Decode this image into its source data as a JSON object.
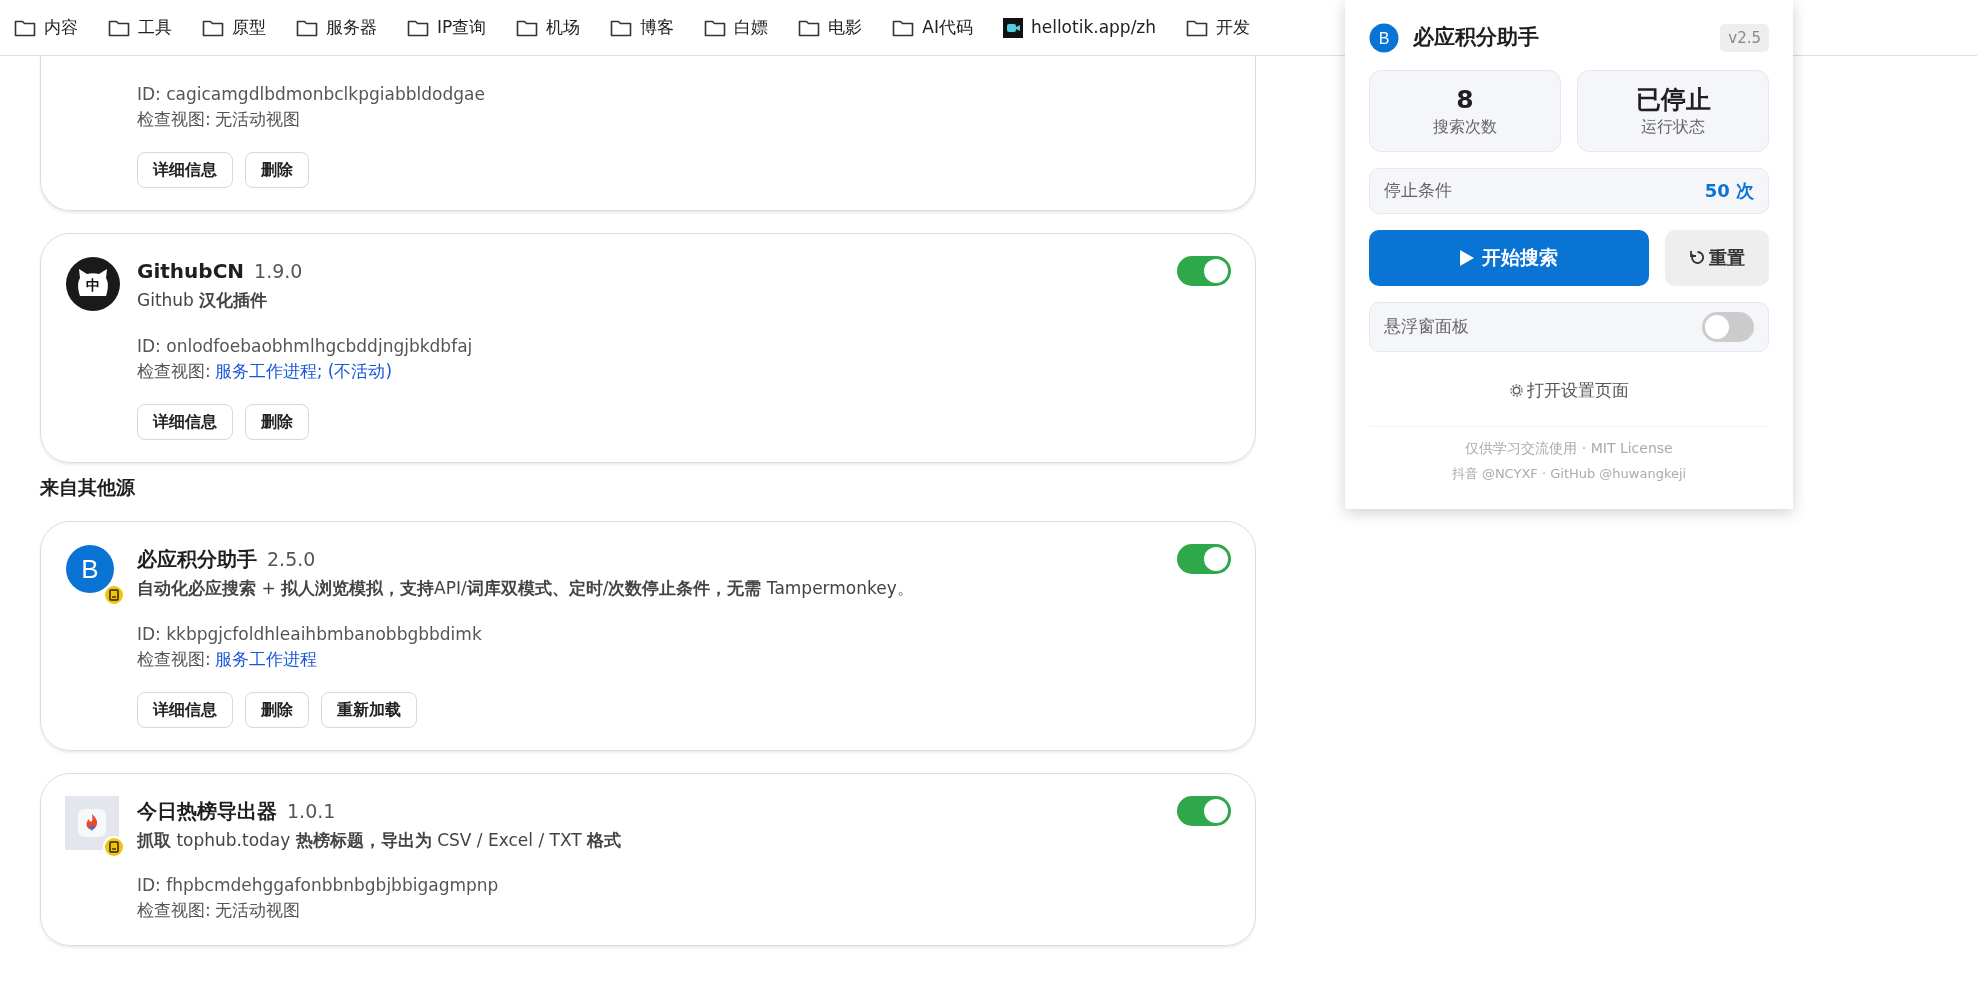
{
  "bookmarks": [
    {
      "label": "内容",
      "kind": "folder"
    },
    {
      "label": "工具",
      "kind": "folder"
    },
    {
      "label": "原型",
      "kind": "folder"
    },
    {
      "label": "服务器",
      "kind": "folder"
    },
    {
      "label": "IP查询",
      "kind": "folder"
    },
    {
      "label": "机场",
      "kind": "folder"
    },
    {
      "label": "博客",
      "kind": "folder"
    },
    {
      "label": "白嫖",
      "kind": "folder"
    },
    {
      "label": "电影",
      "kind": "folder"
    },
    {
      "label": "AI代码",
      "kind": "folder"
    },
    {
      "label": "hellotik.app/zh",
      "kind": "site"
    },
    {
      "label": "开发",
      "kind": "folder"
    }
  ],
  "extensions": [
    {
      "kind": "partial",
      "id": "ID: cagicamgdlbdmonbclkpgiabbldodgae",
      "inspect": {
        "label": "检查视图:",
        "value": "无活动视图",
        "kind": "text"
      },
      "buttons": [
        "详细信息",
        "删除"
      ]
    },
    {
      "kind": "full",
      "icon_text": "中",
      "name": "GithubCN",
      "version": "1.9.0",
      "description": "Github **汉化插件**",
      "id": "ID: onlodfoebaobhmlhgcbddjngjbkdbfaj",
      "inspect": {
        "label": "检查视图:",
        "value": "服务工作进程; (不活动)",
        "kind": "link"
      },
      "buttons": [
        "详细信息",
        "删除"
      ],
      "enabled": true,
      "source_badge": false
    },
    {
      "kind": "heading",
      "text": "来自其他源"
    },
    {
      "kind": "full",
      "icon_text": "B",
      "name": "必应积分助手",
      "version": "2.5.0",
      "description": "**自动化必应搜索** + **拟人浏览模拟，支持**API/**词库双模式、定时**/**次数停止条件，无需** Tampermonkey。",
      "id": "ID: kkbpgjcfoldhleaihbmbanobbgbbdimk",
      "inspect": {
        "label": "检查视图:",
        "value": "服务工作进程",
        "kind": "link"
      },
      "buttons": [
        "详细信息",
        "删除",
        "重新加载"
      ],
      "enabled": true,
      "source_badge": true
    },
    {
      "kind": "full",
      "name": "今日热榜导出器",
      "version": "1.0.1",
      "description": "**抓取** tophub.today **热榜标题，导出为** CSV / Excel / TXT **格式**",
      "id": "ID: fhpbcmdehggafonbbnbgbjbbigagmpnp",
      "inspect": {
        "label": "检查视图:",
        "value": "无活动视图",
        "kind": "text"
      },
      "enabled": true,
      "source_badge": true
    }
  ],
  "popup": {
    "logo_letter": "B",
    "title": "必应积分助手",
    "version": "v2.5",
    "stats": [
      {
        "value": "8",
        "label": "搜索次数"
      },
      {
        "value": "已停止",
        "label": "运行状态"
      }
    ],
    "stop_condition": {
      "label": "停止条件",
      "value": "50 次"
    },
    "start_button": "开始搜索",
    "reset_button": "重置",
    "floating_panel": {
      "label": "悬浮窗面板",
      "on": false
    },
    "settings_link": "打开设置页面",
    "footer": [
      "仅供学习交流使用 · MIT License",
      "抖音 @NCYXF · GitHub @huwangkeji"
    ]
  }
}
